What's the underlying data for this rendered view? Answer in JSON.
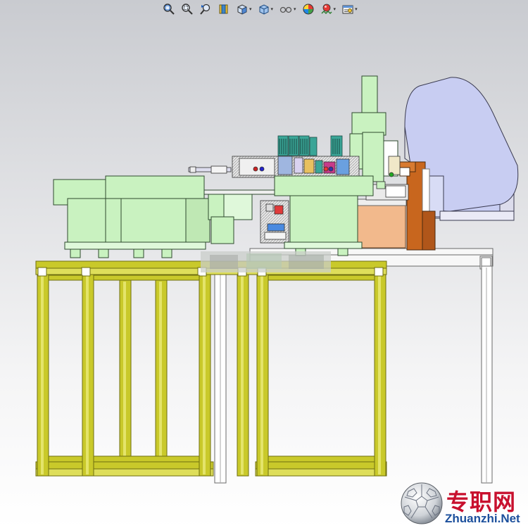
{
  "toolbar": {
    "items": [
      {
        "icon": "zoom-to-fit-icon",
        "dropdown": false
      },
      {
        "icon": "zoom-to-area-icon",
        "dropdown": false
      },
      {
        "icon": "previous-view-icon",
        "dropdown": false
      },
      {
        "icon": "section-view-icon",
        "dropdown": false
      },
      {
        "icon": "view-orientation-icon",
        "dropdown": true
      },
      {
        "icon": "display-style-icon",
        "dropdown": true
      },
      {
        "icon": "hide-show-items-icon",
        "dropdown": true
      },
      {
        "icon": "edit-appearance-icon",
        "dropdown": false
      },
      {
        "icon": "apply-scene-icon",
        "dropdown": true
      },
      {
        "icon": "view-settings-icon",
        "dropdown": true
      }
    ],
    "dropdown_glyph": "▾"
  },
  "watermark": {
    "chinese": "专职网",
    "english": "Zhuanzhi.Net"
  },
  "colors": {
    "frame_yellow": "#c9c92a",
    "frame_yellow_dark": "#6e6e10",
    "part_green": "#c9f2c0",
    "cylinder_lavender": "#c8cdf2",
    "bracket_orange": "#c8661e",
    "block_peach": "#f2b98c",
    "watermark_red": "#c8102e",
    "watermark_blue": "#1b4f9c"
  }
}
